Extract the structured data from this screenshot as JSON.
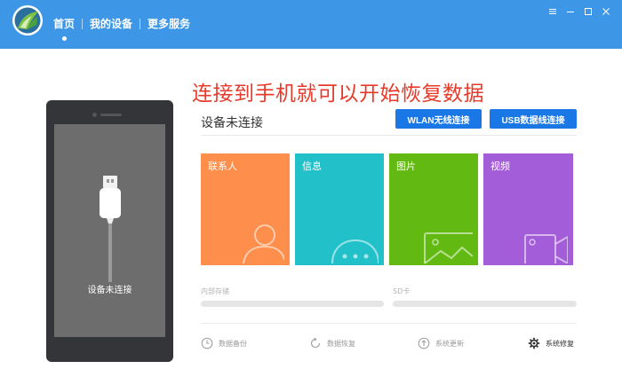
{
  "app": {
    "nav": [
      {
        "label": "首页",
        "active": true
      },
      {
        "label": "我的设备"
      },
      {
        "label": "更多服务"
      }
    ],
    "window_controls": [
      "menu-icon",
      "minimize-icon",
      "maximize-icon",
      "close-icon"
    ]
  },
  "headline": "连接到手机就可以开始恢复数据",
  "phone": {
    "screen_text": "设备未连接"
  },
  "connection": {
    "status": "设备未连接",
    "wlan_button": "WLAN无线连接",
    "usb_button": "USB数据线连接"
  },
  "tiles": [
    {
      "label": "联系人",
      "color": "#fe8e4b",
      "icon": "contact-icon"
    },
    {
      "label": "信息",
      "color": "#22c1c9",
      "icon": "message-icon"
    },
    {
      "label": "图片",
      "color": "#62b911",
      "icon": "picture-icon"
    },
    {
      "label": "视频",
      "color": "#a45dd8",
      "icon": "video-icon"
    }
  ],
  "storage": {
    "internal_label": "内部存储",
    "sd_label": "SD卡"
  },
  "actions": [
    {
      "label": "数据备份",
      "icon": "backup-icon"
    },
    {
      "label": "数据恢复",
      "icon": "restore-icon"
    },
    {
      "label": "系统更新",
      "icon": "update-icon"
    },
    {
      "label": "系统修复",
      "icon": "repair-icon",
      "active": true
    }
  ],
  "colors": {
    "header": "#3d97e6",
    "accent_button": "#1a78e6",
    "headline": "#e83a2a"
  }
}
